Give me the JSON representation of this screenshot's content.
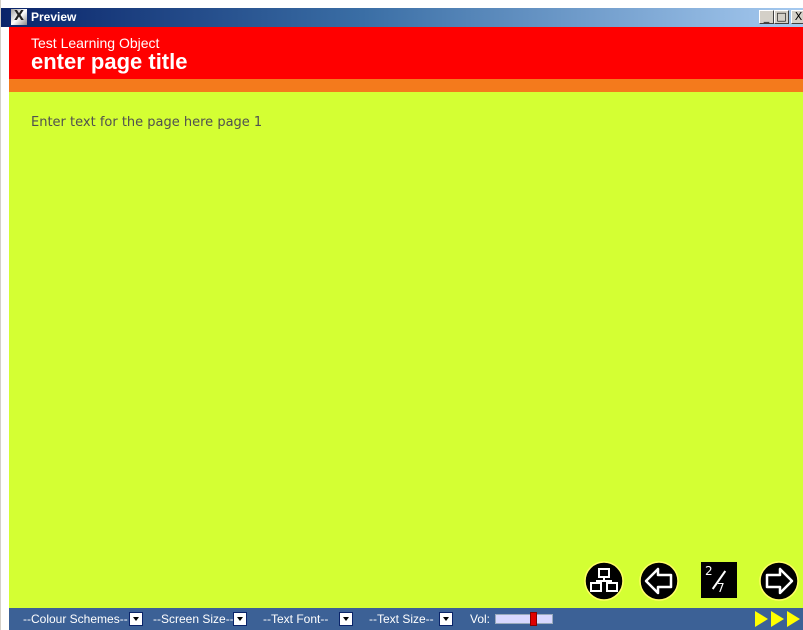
{
  "window": {
    "title": "Preview",
    "min_label": "_",
    "max_label": "□",
    "close_label": "X",
    "app_icon_glyph": "X"
  },
  "header": {
    "subtitle": "Test Learning Object",
    "page_title": "enter page title",
    "color": "#ff0000",
    "band_color": "#f47a1c"
  },
  "content": {
    "text": "Enter text for the page here page 1",
    "background": "#d4ff33"
  },
  "nav": {
    "page_current": "2",
    "page_total": "7",
    "glossary_icon": "sitemap-icon",
    "back_icon": "arrow-left-icon",
    "next_icon": "arrow-right-icon"
  },
  "footer": {
    "colour_schemes": "--Colour Schemes--",
    "screen_size": "--Screen Size--",
    "text_font": "--Text Font--",
    "text_size": "--Text Size--",
    "vol_label": "Vol:",
    "volume_fraction": 0.7,
    "background": "#3c6196",
    "play_icon": "fast-forward-icon"
  }
}
